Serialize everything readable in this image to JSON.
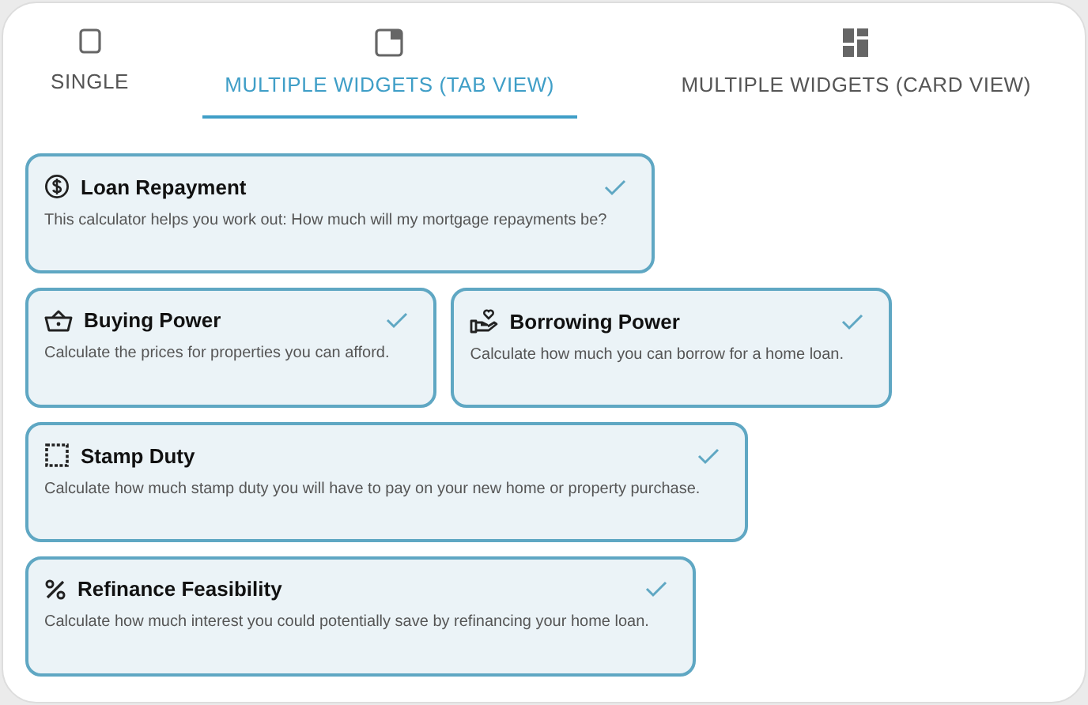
{
  "tabs": [
    {
      "label": "SINGLE",
      "selected": false
    },
    {
      "label": "MULTIPLE WIDGETS (TAB VIEW)",
      "selected": true
    },
    {
      "label": "MULTIPLE WIDGETS (CARD VIEW)",
      "selected": false
    }
  ],
  "card_rows": [
    [
      {
        "title": "Loan Repayment",
        "description": "This calculator helps you work out: How much will my mortgage repayments be?",
        "checked": true
      }
    ],
    [
      {
        "title": "Buying Power",
        "description": "Calculate the prices for properties you can afford.",
        "checked": true
      },
      {
        "title": "Borrowing Power",
        "description": "Calculate how much you can borrow for a home loan.",
        "checked": true
      }
    ],
    [
      {
        "title": "Stamp Duty",
        "description": "Calculate how much stamp duty you will have to pay on your new home or property purchase.",
        "checked": true
      }
    ],
    [
      {
        "title": "Refinance Feasibility",
        "description": "Calculate how much interest you could potentially save by refinancing your home loan.",
        "checked": true
      }
    ]
  ]
}
